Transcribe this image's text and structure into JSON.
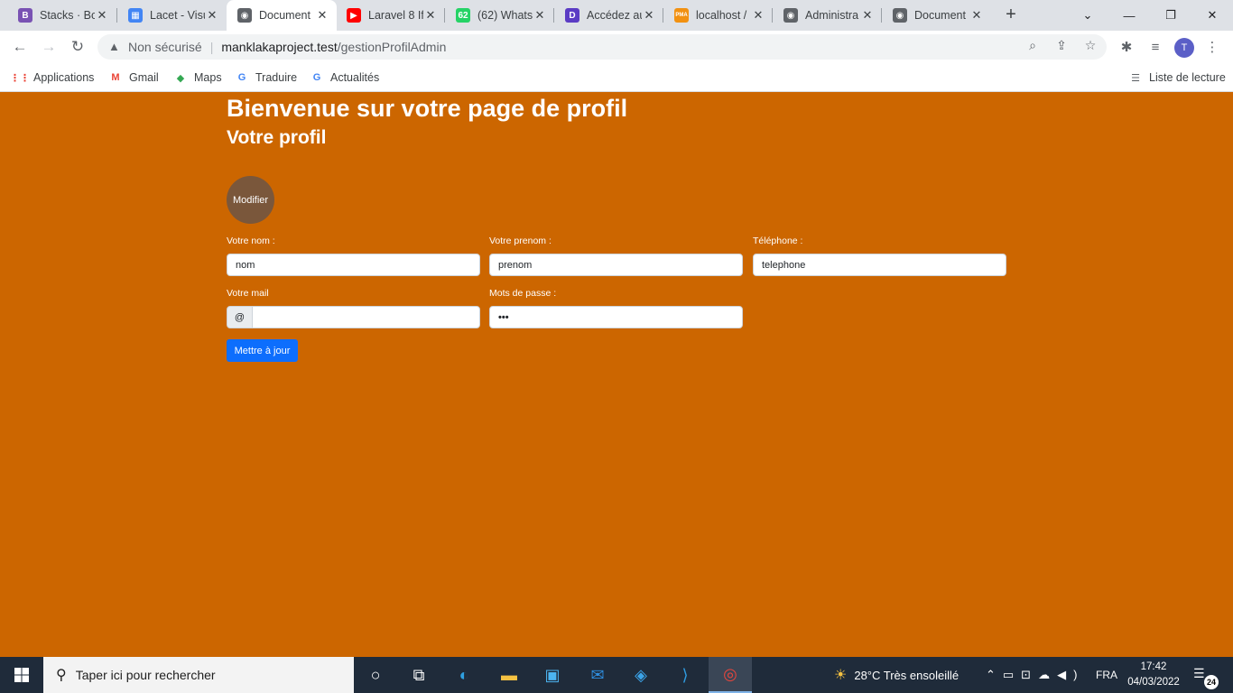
{
  "browser": {
    "tabs": [
      {
        "title": "Stacks · Bo",
        "favicon": "bootstrap-icon",
        "color": "#7952b3",
        "glyph": "B",
        "active": false
      },
      {
        "title": "Lacet - Visu",
        "favicon": "grid-sheet-icon",
        "color": "#4285f4",
        "glyph": "▦",
        "active": false
      },
      {
        "title": "Document",
        "favicon": "globe-icon",
        "color": "#5f6368",
        "glyph": "◉",
        "active": true
      },
      {
        "title": "Laravel 8 If",
        "favicon": "youtube-icon",
        "color": "#ff0000",
        "glyph": "▶",
        "active": false
      },
      {
        "title": "(62) Whats",
        "favicon": "whatsapp-icon",
        "color": "#25d366",
        "glyph": "62",
        "active": false
      },
      {
        "title": "Accédez au",
        "favicon": "app-icon",
        "color": "#5b3cc4",
        "glyph": "D",
        "active": false
      },
      {
        "title": "localhost /",
        "favicon": "phpmyadmin-icon",
        "color": "#f29111",
        "glyph": "PMA",
        "active": false
      },
      {
        "title": "Administra",
        "favicon": "globe-icon",
        "color": "#5f6368",
        "glyph": "◉",
        "active": false
      },
      {
        "title": "Document",
        "favicon": "globe-icon",
        "color": "#5f6368",
        "glyph": "◉",
        "active": false
      }
    ],
    "security_label": "Non sécurisé",
    "url_host": "manklakaproject.test",
    "url_path": "/gestionProfilAdmin",
    "bookmarks": [
      {
        "label": "Applications",
        "icon": "apps-grid-icon",
        "color": "#ea4335",
        "glyph": "⋮⋮"
      },
      {
        "label": "Gmail",
        "icon": "gmail-icon",
        "color": "#ea4335",
        "glyph": "M"
      },
      {
        "label": "Maps",
        "icon": "maps-pin-icon",
        "color": "#34a853",
        "glyph": "◆"
      },
      {
        "label": "Traduire",
        "icon": "translate-icon",
        "color": "#4285f4",
        "glyph": "G"
      },
      {
        "label": "Actualités",
        "icon": "news-icon",
        "color": "#4285f4",
        "glyph": "G"
      }
    ],
    "reading_list": "Liste de lecture",
    "profile_initial": "T"
  },
  "page": {
    "title": "Bienvenue sur votre page de profil",
    "subtitle": "Votre profil",
    "avatar_button": "Modifier",
    "fields": {
      "nom": {
        "label": "Votre nom :",
        "value": "nom"
      },
      "prenom": {
        "label": "Votre prenom :",
        "value": "prenom"
      },
      "telephone": {
        "label": "Téléphone :",
        "value": "telephone"
      },
      "mail": {
        "label": "Votre mail",
        "prefix": "@",
        "value": ""
      },
      "password": {
        "label": "Mots de passe :",
        "value": "•••"
      }
    },
    "submit": "Mettre à jour",
    "background": "#cc6600",
    "button_color": "#0d6efd"
  },
  "taskbar": {
    "search_placeholder": "Taper ici pour rechercher",
    "weather": "28°C  Très ensoleillé",
    "language": "FRA",
    "time": "17:42",
    "date": "04/03/2022",
    "notifications": "24"
  }
}
